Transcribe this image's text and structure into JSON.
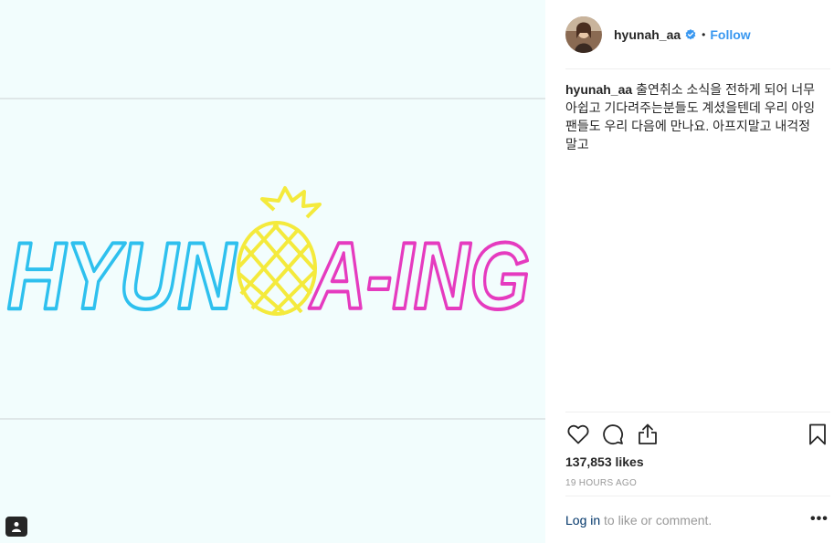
{
  "media": {
    "background": "#f2fdfd",
    "logo": {
      "text_left": "HYUN",
      "text_right": "A-ING",
      "color_left": "#2ec0ee",
      "color_right": "#e53bbf",
      "color_pineapple": "#f4ea3c"
    },
    "tag_icon": "user-tag-icon"
  },
  "header": {
    "username": "hyunah_aa",
    "verified_icon": "verified-badge-icon",
    "separator": "•",
    "follow_label": "Follow"
  },
  "caption": {
    "username": "hyunah_aa",
    "text": "출연취소 소식을 전하게 되어 너무 아쉽고 기다려주는분들도 계셨을텐데 우리 아잉 팬들도 우리 다음에 만나요. 아프지말고 내걱정말고"
  },
  "actions": {
    "like_icon": "heart-icon",
    "comment_icon": "comment-icon",
    "share_icon": "share-icon",
    "save_icon": "bookmark-icon"
  },
  "likes": "137,853 likes",
  "timestamp": "19 HOURS AGO",
  "footer": {
    "login_label": "Log in",
    "login_suffix": " to like or comment.",
    "more_label": "•••"
  },
  "colors": {
    "link_blue": "#3897f0",
    "text": "#262626",
    "muted": "#999999"
  }
}
